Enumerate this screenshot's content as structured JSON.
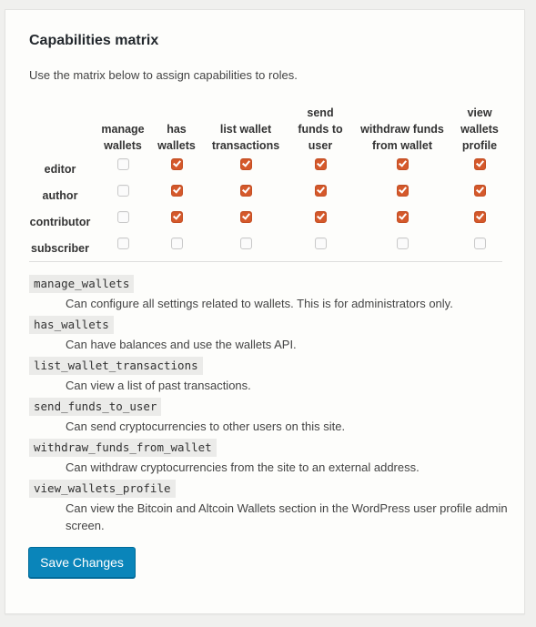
{
  "page": {
    "title": "Capabilities matrix",
    "intro": "Use the matrix below to assign capabilities to roles."
  },
  "matrix": {
    "columns": [
      {
        "key": "manage_wallets",
        "label_lines": [
          "manage",
          "wallets"
        ]
      },
      {
        "key": "has_wallets",
        "label_lines": [
          "has",
          "wallets"
        ]
      },
      {
        "key": "list_wallet_transactions",
        "label_lines": [
          "list wallet",
          "transactions"
        ]
      },
      {
        "key": "send_funds_to_user",
        "label_lines": [
          "send",
          "funds to",
          "user"
        ]
      },
      {
        "key": "withdraw_funds_from_wallet",
        "label_lines": [
          "withdraw funds",
          "from wallet"
        ]
      },
      {
        "key": "view_wallets_profile",
        "label_lines": [
          "view",
          "wallets",
          "profile"
        ]
      }
    ],
    "rows": [
      {
        "role": "editor",
        "checked": [
          false,
          true,
          true,
          true,
          true,
          true
        ]
      },
      {
        "role": "author",
        "checked": [
          false,
          true,
          true,
          true,
          true,
          true
        ]
      },
      {
        "role": "contributor",
        "checked": [
          false,
          true,
          true,
          true,
          true,
          true
        ]
      },
      {
        "role": "subscriber",
        "checked": [
          false,
          false,
          false,
          false,
          false,
          false
        ]
      }
    ],
    "checked_color": "#d5592b"
  },
  "capabilities": [
    {
      "code": "manage_wallets",
      "description": "Can configure all settings related to wallets. This is for administrators only."
    },
    {
      "code": "has_wallets",
      "description": "Can have balances and use the wallets API."
    },
    {
      "code": "list_wallet_transactions",
      "description": "Can view a list of past transactions."
    },
    {
      "code": "send_funds_to_user",
      "description": "Can send cryptocurrencies to other users on this site."
    },
    {
      "code": "withdraw_funds_from_wallet",
      "description": "Can withdraw cryptocurrencies from the site to an external address."
    },
    {
      "code": "view_wallets_profile",
      "description": "Can view the Bitcoin and Altcoin Wallets section in the WordPress user profile admin screen."
    }
  ],
  "actions": {
    "save_label": "Save Changes",
    "save_color": "#0a85ba"
  }
}
